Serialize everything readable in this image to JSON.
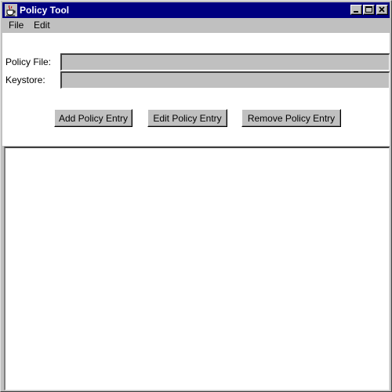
{
  "window": {
    "title": "Policy Tool",
    "icon": "java-cup-icon"
  },
  "title_buttons": {
    "minimize_icon": "minimize-icon",
    "maximize_icon": "maximize-icon",
    "close_icon": "close-icon"
  },
  "menu": {
    "items": [
      {
        "label": "File"
      },
      {
        "label": "Edit"
      }
    ]
  },
  "form": {
    "policy_file": {
      "label": "Policy File:",
      "value": ""
    },
    "keystore": {
      "label": "Keystore:",
      "value": ""
    }
  },
  "actions": {
    "add_label": "Add Policy Entry",
    "edit_label": "Edit Policy Entry",
    "remove_label": "Remove Policy Entry"
  },
  "policy_entries": [],
  "colors": {
    "titlebar": "#000080",
    "title_text": "#ffffff",
    "face": "#c0c0c0",
    "panel": "#ffffff"
  }
}
